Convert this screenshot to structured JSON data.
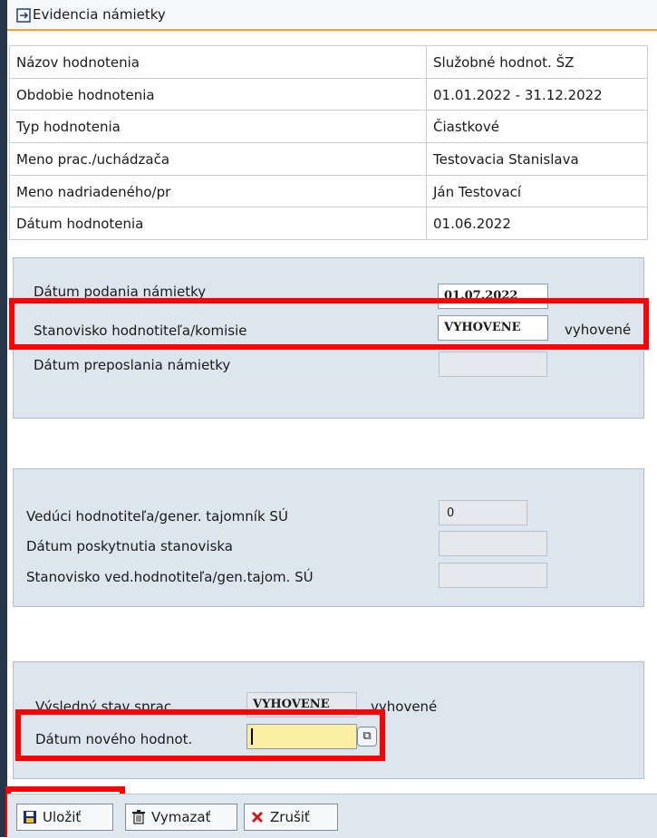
{
  "title": "Evidencia námietky",
  "header_rows": [
    {
      "label": "Názov hodnotenia",
      "value": "Služobné hodnot. ŠZ"
    },
    {
      "label": "Obdobie hodnotenia",
      "value": "01.01.2022 - 31.12.2022"
    },
    {
      "label": "Typ hodnotenia",
      "value": "Čiastkové"
    },
    {
      "label": "Meno prac./uchádzača",
      "value": "Testovacia Stanislava"
    },
    {
      "label": "Meno nadriadeného/pr",
      "value": "Ján Testovací"
    },
    {
      "label": "Dátum hodnotenia",
      "value": "01.06.2022"
    }
  ],
  "objection": {
    "filed_label": "Dátum podania námietky",
    "filed_value": "01.07.2022",
    "position_label": "Stanovisko hodnotiteľa/komisie",
    "position_value": "VYHOVENE",
    "position_text": "vyhovené",
    "forwarded_label": "Dátum preposlania námietky",
    "forwarded_value": ""
  },
  "leader": {
    "evaluator_label": "Vedúci hodnotiteľa/gener. tajomník SÚ",
    "evaluator_value": "0",
    "date_label": "Dátum poskytnutia stanoviska",
    "date_value": "",
    "position_label": "Stanovisko ved.hodnotiteľa/gen.tajom. SÚ",
    "position_value": ""
  },
  "result": {
    "state_label": "Výsledný stav sprac.",
    "state_value": "VYHOVENE",
    "state_text": "vyhovené",
    "new_date_label": "Dátum nového hodnot.",
    "new_date_value": ""
  },
  "toolbar": {
    "save_label": "Uložiť",
    "delete_label": "Vymazať",
    "cancel_label": "Zrušiť"
  },
  "colors": {
    "highlight": "#ff0000",
    "group_bg": "#dde6ef",
    "required_field": "#fbeea0",
    "title_underline": "#f0a43a"
  },
  "icons": [
    "exit-icon",
    "save-icon",
    "delete-icon",
    "cancel-icon",
    "value-help-icon"
  ]
}
